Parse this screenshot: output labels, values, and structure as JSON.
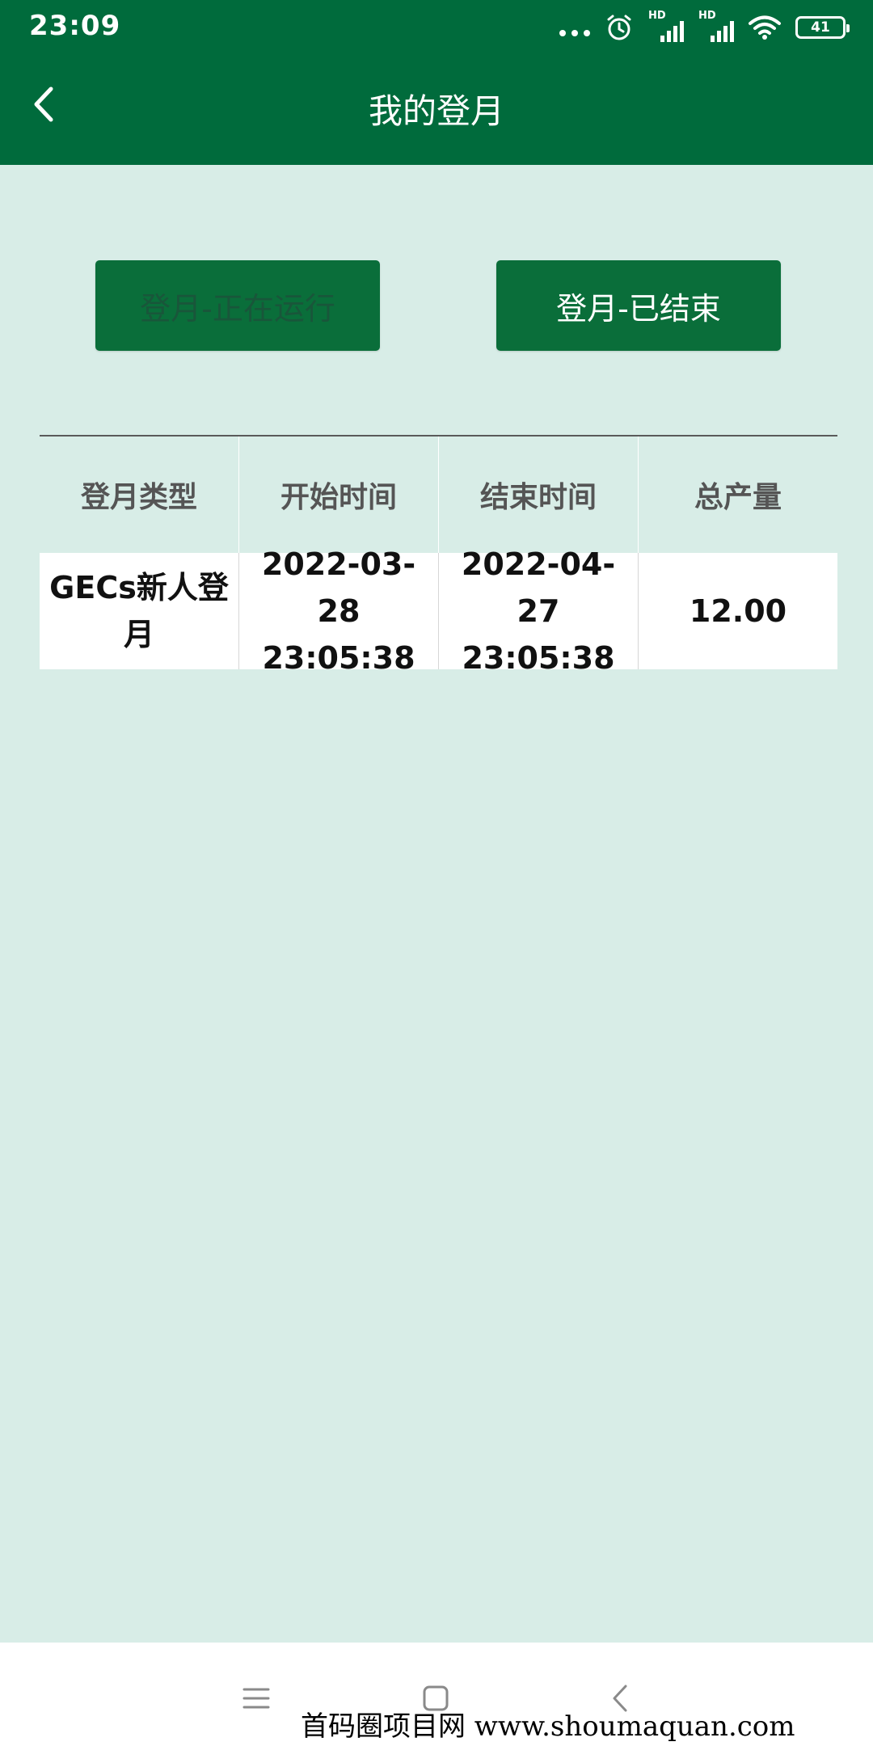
{
  "status_bar": {
    "time": "23:09",
    "signal_label_1": "HD",
    "signal_label_2": "HD",
    "battery": "41",
    "icons": [
      "more-dots-icon",
      "alarm-icon",
      "signal-hd-icon",
      "signal-hd-icon",
      "wifi-icon",
      "battery-icon"
    ]
  },
  "app_bar": {
    "title": "我的登月",
    "back_icon": "chevron-left-icon"
  },
  "tabs": [
    {
      "label": "登月-正在运行",
      "active": true
    },
    {
      "label": "登月-已结束",
      "active": false
    }
  ],
  "table": {
    "headers": [
      "登月类型",
      "开始时间",
      "结束时间",
      "总产量"
    ],
    "rows": [
      {
        "type_line1": "GECs新人登",
        "type_line2": "月",
        "start_date": "2022-03-28",
        "start_time": "23:05:38",
        "end_date": "2022-04-27",
        "end_time": "23:05:38",
        "total": "12.00"
      }
    ]
  },
  "system_nav": {
    "icons": [
      "menu-icon",
      "home-square-icon",
      "back-chevron-icon"
    ]
  },
  "watermark": "首码圈项目网 www.shoumaquan.com",
  "colors": {
    "header_bg": "#006b3c",
    "page_bg": "#d8ede7",
    "button_bg": "#0a6e3a",
    "button_text_active": "#19563a",
    "button_text": "#ffffff"
  }
}
